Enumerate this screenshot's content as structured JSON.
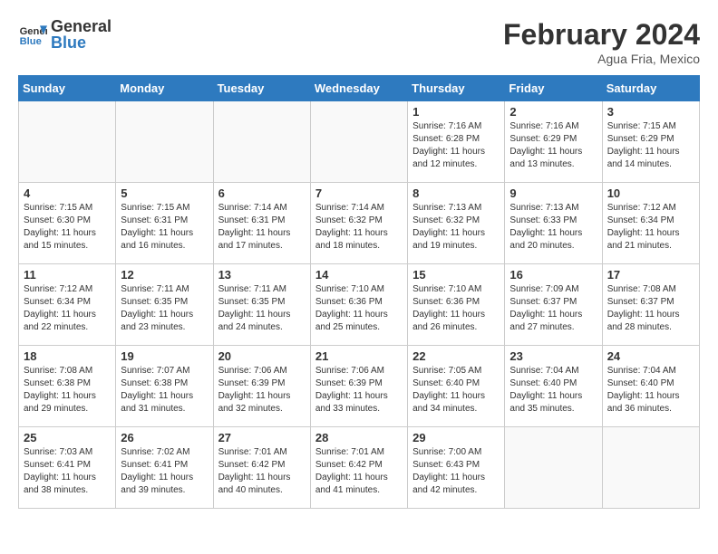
{
  "header": {
    "logo_line1": "General",
    "logo_line2": "Blue",
    "month_title": "February 2024",
    "location": "Agua Fria, Mexico"
  },
  "days_of_week": [
    "Sunday",
    "Monday",
    "Tuesday",
    "Wednesday",
    "Thursday",
    "Friday",
    "Saturday"
  ],
  "weeks": [
    [
      {
        "day": "",
        "info": ""
      },
      {
        "day": "",
        "info": ""
      },
      {
        "day": "",
        "info": ""
      },
      {
        "day": "",
        "info": ""
      },
      {
        "day": "1",
        "info": "Sunrise: 7:16 AM\nSunset: 6:28 PM\nDaylight: 11 hours and 12 minutes."
      },
      {
        "day": "2",
        "info": "Sunrise: 7:16 AM\nSunset: 6:29 PM\nDaylight: 11 hours and 13 minutes."
      },
      {
        "day": "3",
        "info": "Sunrise: 7:15 AM\nSunset: 6:29 PM\nDaylight: 11 hours and 14 minutes."
      }
    ],
    [
      {
        "day": "4",
        "info": "Sunrise: 7:15 AM\nSunset: 6:30 PM\nDaylight: 11 hours and 15 minutes."
      },
      {
        "day": "5",
        "info": "Sunrise: 7:15 AM\nSunset: 6:31 PM\nDaylight: 11 hours and 16 minutes."
      },
      {
        "day": "6",
        "info": "Sunrise: 7:14 AM\nSunset: 6:31 PM\nDaylight: 11 hours and 17 minutes."
      },
      {
        "day": "7",
        "info": "Sunrise: 7:14 AM\nSunset: 6:32 PM\nDaylight: 11 hours and 18 minutes."
      },
      {
        "day": "8",
        "info": "Sunrise: 7:13 AM\nSunset: 6:32 PM\nDaylight: 11 hours and 19 minutes."
      },
      {
        "day": "9",
        "info": "Sunrise: 7:13 AM\nSunset: 6:33 PM\nDaylight: 11 hours and 20 minutes."
      },
      {
        "day": "10",
        "info": "Sunrise: 7:12 AM\nSunset: 6:34 PM\nDaylight: 11 hours and 21 minutes."
      }
    ],
    [
      {
        "day": "11",
        "info": "Sunrise: 7:12 AM\nSunset: 6:34 PM\nDaylight: 11 hours and 22 minutes."
      },
      {
        "day": "12",
        "info": "Sunrise: 7:11 AM\nSunset: 6:35 PM\nDaylight: 11 hours and 23 minutes."
      },
      {
        "day": "13",
        "info": "Sunrise: 7:11 AM\nSunset: 6:35 PM\nDaylight: 11 hours and 24 minutes."
      },
      {
        "day": "14",
        "info": "Sunrise: 7:10 AM\nSunset: 6:36 PM\nDaylight: 11 hours and 25 minutes."
      },
      {
        "day": "15",
        "info": "Sunrise: 7:10 AM\nSunset: 6:36 PM\nDaylight: 11 hours and 26 minutes."
      },
      {
        "day": "16",
        "info": "Sunrise: 7:09 AM\nSunset: 6:37 PM\nDaylight: 11 hours and 27 minutes."
      },
      {
        "day": "17",
        "info": "Sunrise: 7:08 AM\nSunset: 6:37 PM\nDaylight: 11 hours and 28 minutes."
      }
    ],
    [
      {
        "day": "18",
        "info": "Sunrise: 7:08 AM\nSunset: 6:38 PM\nDaylight: 11 hours and 29 minutes."
      },
      {
        "day": "19",
        "info": "Sunrise: 7:07 AM\nSunset: 6:38 PM\nDaylight: 11 hours and 31 minutes."
      },
      {
        "day": "20",
        "info": "Sunrise: 7:06 AM\nSunset: 6:39 PM\nDaylight: 11 hours and 32 minutes."
      },
      {
        "day": "21",
        "info": "Sunrise: 7:06 AM\nSunset: 6:39 PM\nDaylight: 11 hours and 33 minutes."
      },
      {
        "day": "22",
        "info": "Sunrise: 7:05 AM\nSunset: 6:40 PM\nDaylight: 11 hours and 34 minutes."
      },
      {
        "day": "23",
        "info": "Sunrise: 7:04 AM\nSunset: 6:40 PM\nDaylight: 11 hours and 35 minutes."
      },
      {
        "day": "24",
        "info": "Sunrise: 7:04 AM\nSunset: 6:40 PM\nDaylight: 11 hours and 36 minutes."
      }
    ],
    [
      {
        "day": "25",
        "info": "Sunrise: 7:03 AM\nSunset: 6:41 PM\nDaylight: 11 hours and 38 minutes."
      },
      {
        "day": "26",
        "info": "Sunrise: 7:02 AM\nSunset: 6:41 PM\nDaylight: 11 hours and 39 minutes."
      },
      {
        "day": "27",
        "info": "Sunrise: 7:01 AM\nSunset: 6:42 PM\nDaylight: 11 hours and 40 minutes."
      },
      {
        "day": "28",
        "info": "Sunrise: 7:01 AM\nSunset: 6:42 PM\nDaylight: 11 hours and 41 minutes."
      },
      {
        "day": "29",
        "info": "Sunrise: 7:00 AM\nSunset: 6:43 PM\nDaylight: 11 hours and 42 minutes."
      },
      {
        "day": "",
        "info": ""
      },
      {
        "day": "",
        "info": ""
      }
    ]
  ]
}
